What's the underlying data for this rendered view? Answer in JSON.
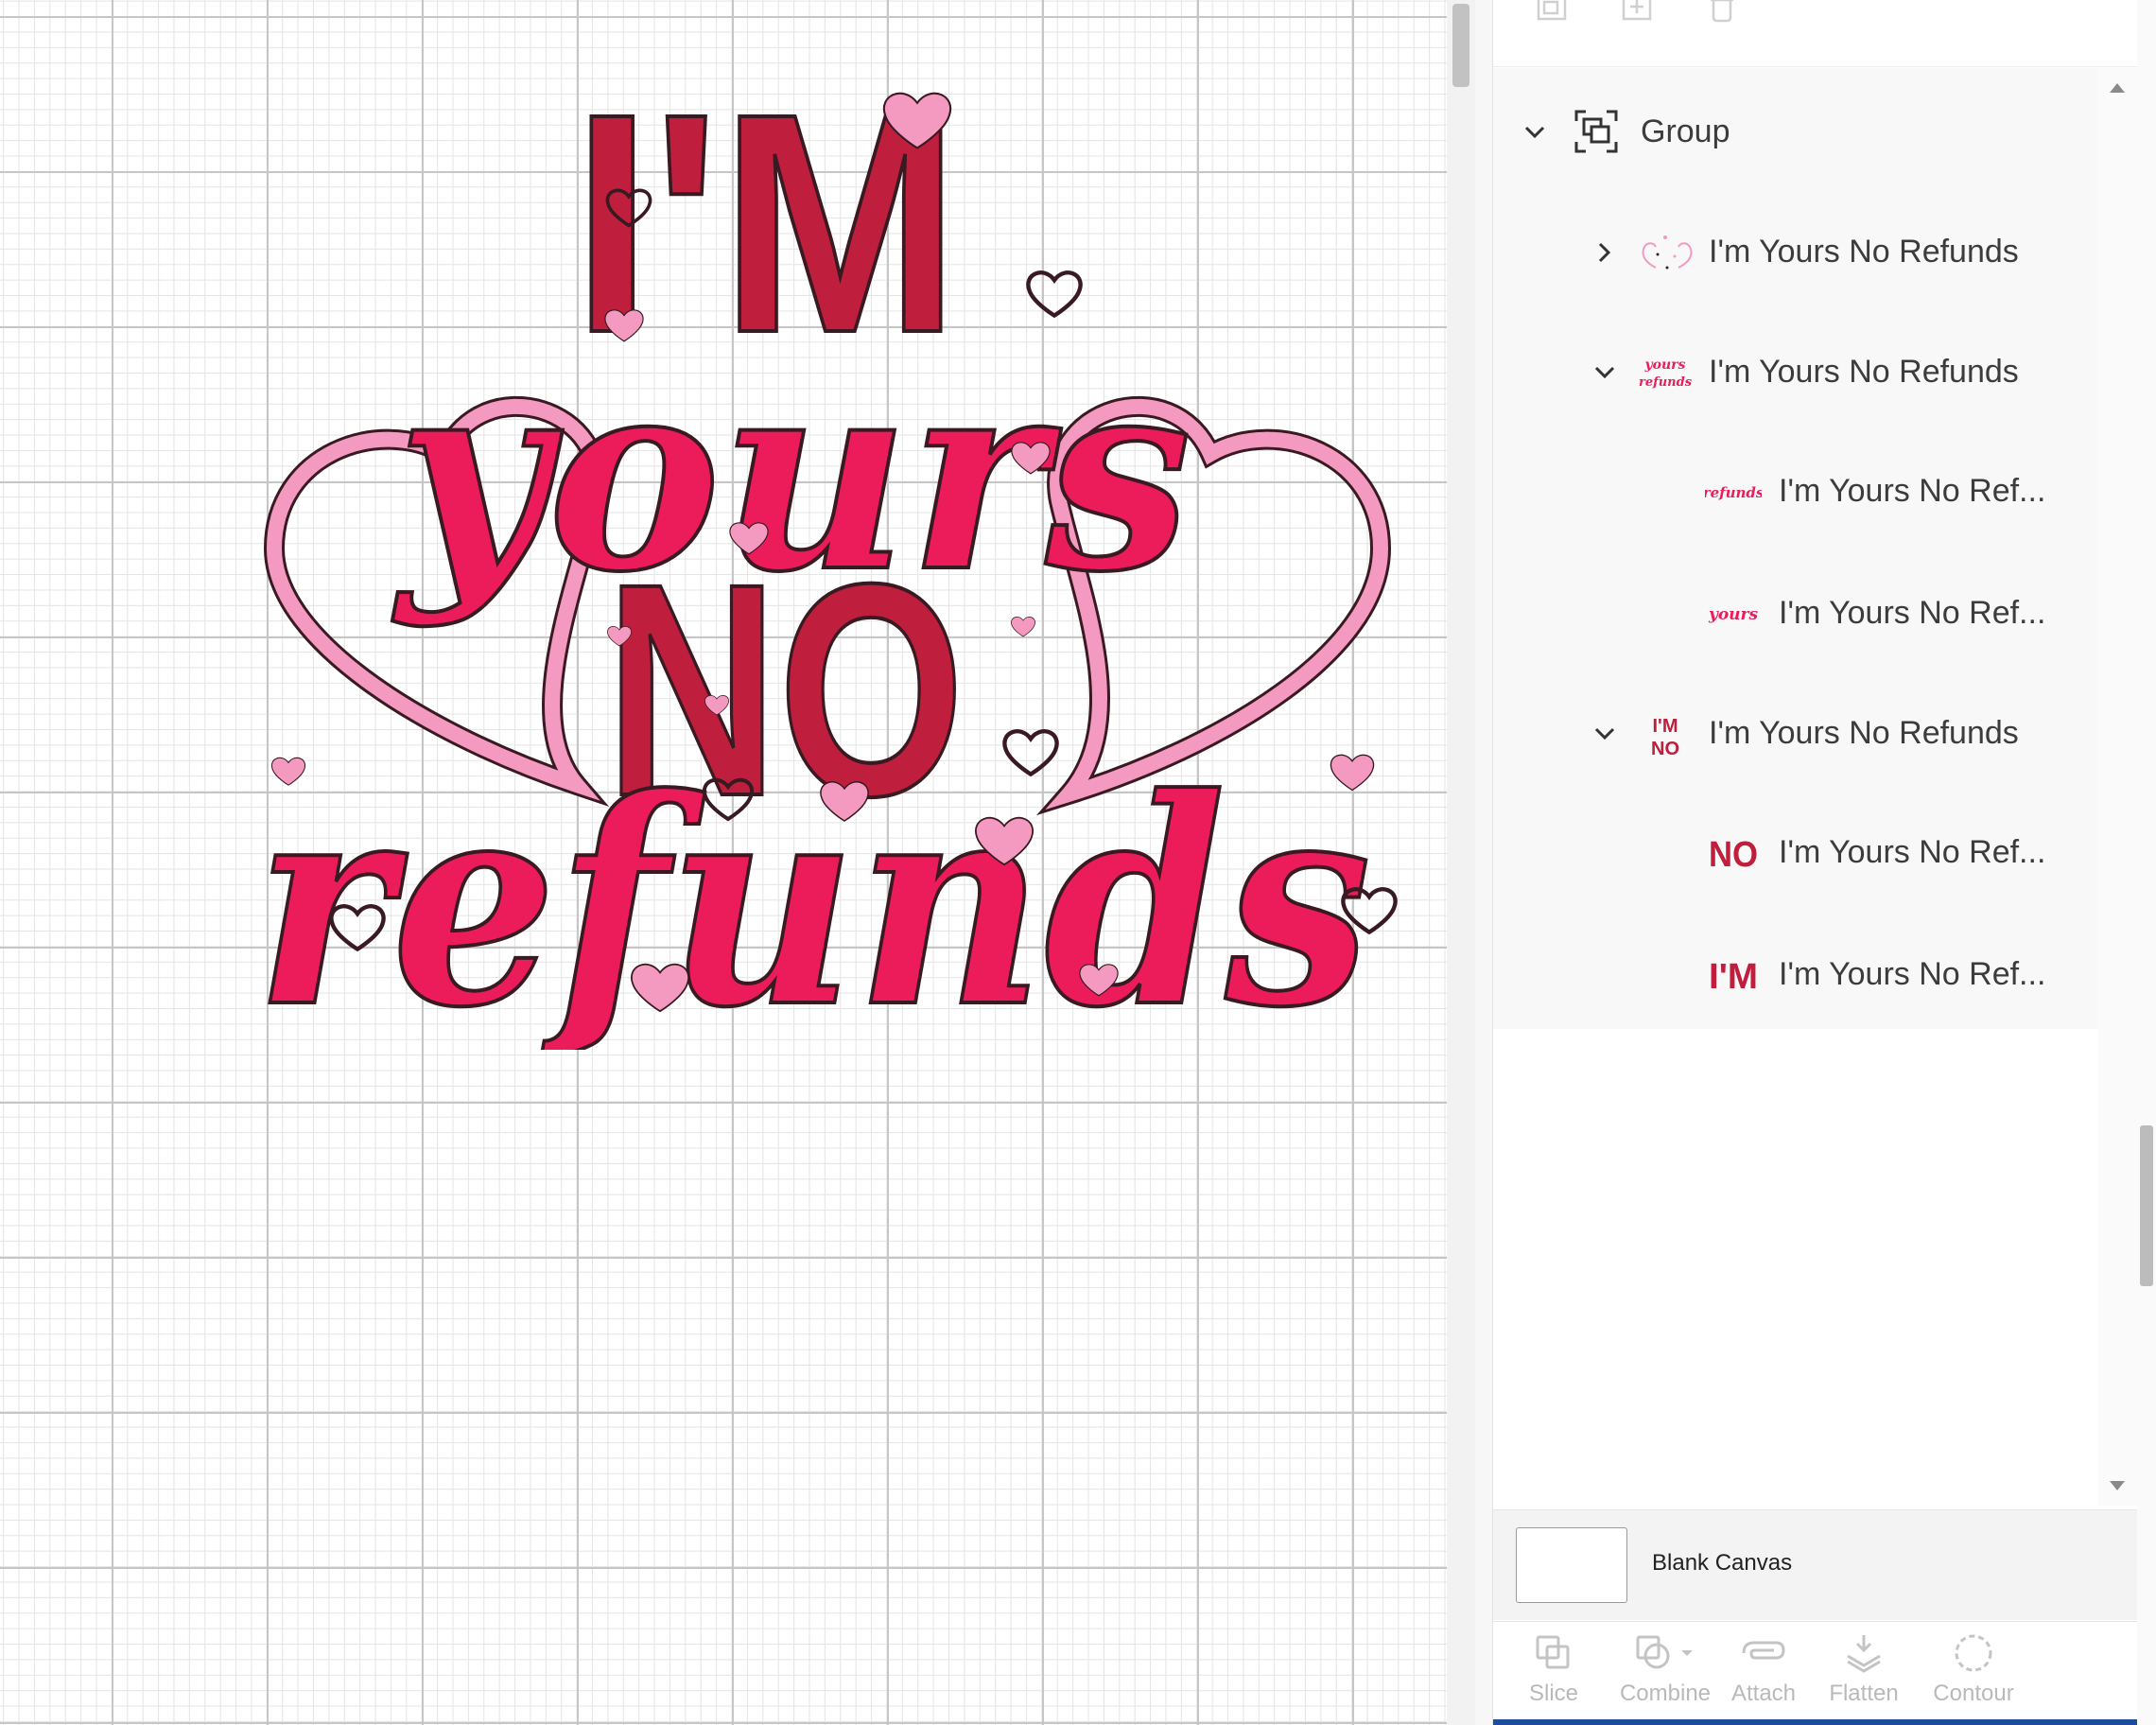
{
  "colors": {
    "accent_blue": "#1e4d9c",
    "dark_red": "#bf1e3c",
    "hot_pink": "#ec1c5a",
    "light_pink": "#f49ac1",
    "outline": "#3a1a22"
  },
  "artwork": {
    "line1": "I'M",
    "line2": "yours",
    "line3": "NO",
    "line4": "refunds"
  },
  "layers": {
    "items": [
      {
        "label": "Group",
        "chevron": "chevron-down-icon",
        "icon": "group-icon"
      },
      {
        "label": "I'm Yours No Refunds",
        "chevron": "chevron-right-icon",
        "thumb": "hearts-thumbnail"
      },
      {
        "label": "I'm Yours No Refunds",
        "chevron": "chevron-down-icon",
        "thumb": "yours-refunds-thumbnail"
      },
      {
        "label": "I'm Yours No Ref...",
        "thumb": "refunds-thumbnail"
      },
      {
        "label": "I'm Yours No Ref...",
        "thumb": "yours-thumbnail"
      },
      {
        "label": "I'm Yours No Refunds",
        "chevron": "chevron-down-icon",
        "thumb": "im-no-thumbnail"
      },
      {
        "label": "I'm Yours No Ref...",
        "thumb": "no-thumbnail"
      },
      {
        "label": "I'm Yours No Ref...",
        "thumb": "im-thumbnail"
      }
    ]
  },
  "thumb_text": {
    "t2_a": "yours",
    "t2_b": "refunds",
    "t3": "refunds",
    "t4": "yours",
    "t5_a": "I'M",
    "t5_b": "NO",
    "t6": "NO",
    "t7": "I'M"
  },
  "canvas_selector": {
    "label": "Blank Canvas"
  },
  "toolbar": {
    "slice": "Slice",
    "combine": "Combine",
    "attach": "Attach",
    "flatten": "Flatten",
    "contour": "Contour"
  }
}
